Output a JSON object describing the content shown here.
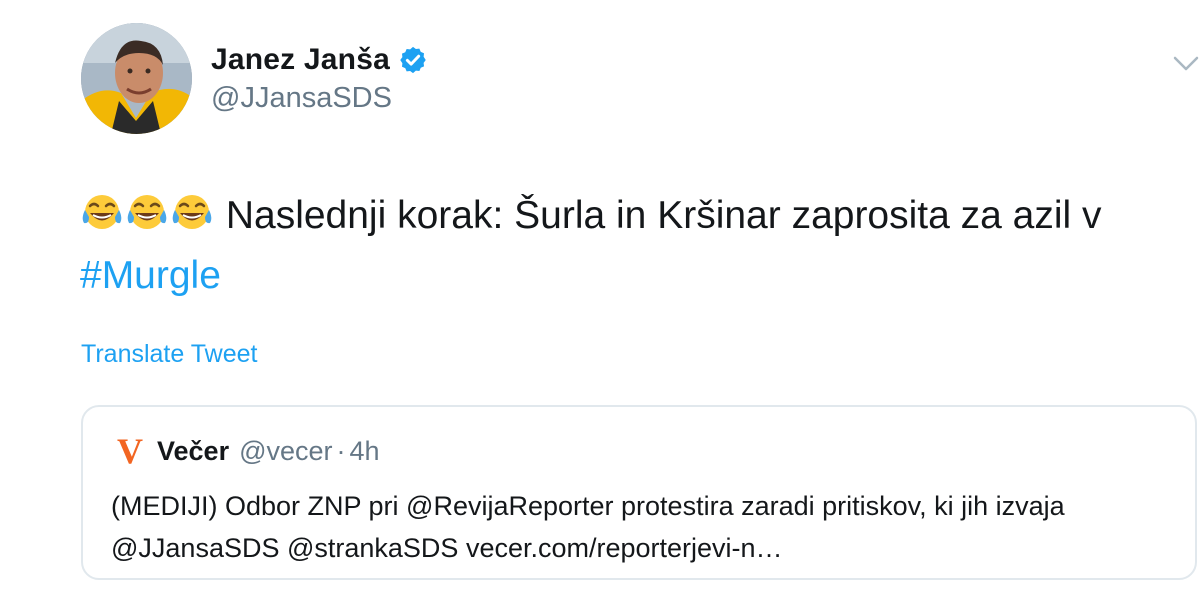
{
  "colors": {
    "link_blue": "#1da1f2",
    "secondary_text": "#657786",
    "primary_text": "#14171a",
    "card_border": "#e1e8ed",
    "vecer_orange": "#f26522"
  },
  "tweet": {
    "author": {
      "display_name": "Janez Janša",
      "handle": "@JJansaSDS",
      "verified": true,
      "avatar_icon": "profile-photo"
    },
    "menu_icon": "chevron-down-icon",
    "emojis": [
      "😂",
      "😂",
      "😂"
    ],
    "text": " Naslednji korak: Šurla in Kršinar zaprosita za azil v ",
    "hashtag": "#Murgle",
    "translate_label": "Translate Tweet"
  },
  "quoted_tweet": {
    "logo": "V",
    "name": "Večer",
    "handle": "@vecer",
    "separator": "·",
    "time": "4h",
    "text": "(MEDIJI) Odbor ZNP pri @RevijaReporter protestira zaradi pritiskov, ki jih izvaja @JJansaSDS @strankaSDS vecer.com/reporterjevi-n…"
  }
}
